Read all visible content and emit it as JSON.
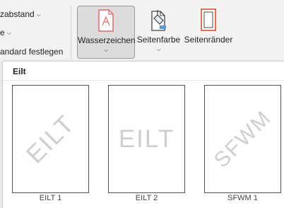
{
  "ribbon": {
    "spacing_label": "zabstand",
    "small_label": "e",
    "set_default_label": "andard festlegen",
    "watermark_label": "Wasserzeichen",
    "pagecolor_label": "Seitenfarbe",
    "pageborders_label": "Seitenränder"
  },
  "gallery": {
    "section_title": "Eilt",
    "items": [
      {
        "text": "EILT",
        "caption": "EILT 1",
        "style": "diagonal"
      },
      {
        "text": "EILT",
        "caption": "EILT 2",
        "style": "horizontal"
      },
      {
        "text": "SFWM",
        "caption": "SFWM 1",
        "style": "diagonal"
      }
    ]
  },
  "colors": {
    "accent_orange": "#d35230",
    "watermark_gray": "#cfcfcf",
    "watermark_icon": "#e06a6a"
  }
}
